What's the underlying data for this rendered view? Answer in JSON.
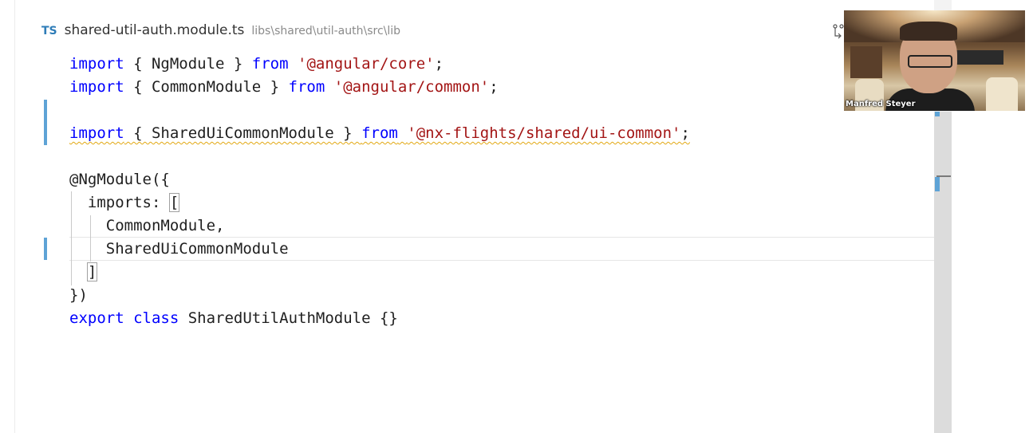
{
  "tab": {
    "language_badge": "TS",
    "filename": "shared-util-auth.module.ts",
    "path": "libs\\shared\\util-auth\\src\\lib"
  },
  "code": {
    "l1": {
      "kw1": "import",
      "t1": " { NgModule } ",
      "kw2": "from",
      "t2": " ",
      "str": "'@angular/core'",
      "t3": ";"
    },
    "l2": {
      "kw1": "import",
      "t1": " { CommonModule } ",
      "kw2": "from",
      "t2": " ",
      "str": "'@angular/common'",
      "t3": ";"
    },
    "l4": {
      "kw1": "import",
      "t1": " { SharedUiCommonModule } ",
      "kw2": "from",
      "t2": " ",
      "str": "'@nx-flights/shared/ui-common'",
      "t3": ";"
    },
    "l6": "@NgModule({",
    "l7_text": "  imports: ",
    "l7_bracket": "[",
    "l8": "    CommonModule,",
    "l9": "    SharedUiCommonModule",
    "l10_pre": "  ",
    "l10_bracket": "]",
    "l11": "})",
    "l12": {
      "kw1": "export",
      "t1": " ",
      "kw2": "class",
      "t2": " SharedUtilAuthModule {}"
    }
  },
  "webcam": {
    "participant_name": "Manfred Steyer"
  },
  "colors": {
    "keyword": "#0000ff",
    "string": "#a31515",
    "modified_gutter": "#5ea3d6",
    "warning_squiggle": "#e2a812"
  },
  "icons": [
    "typescript-badge-icon",
    "split-editor-icon"
  ]
}
